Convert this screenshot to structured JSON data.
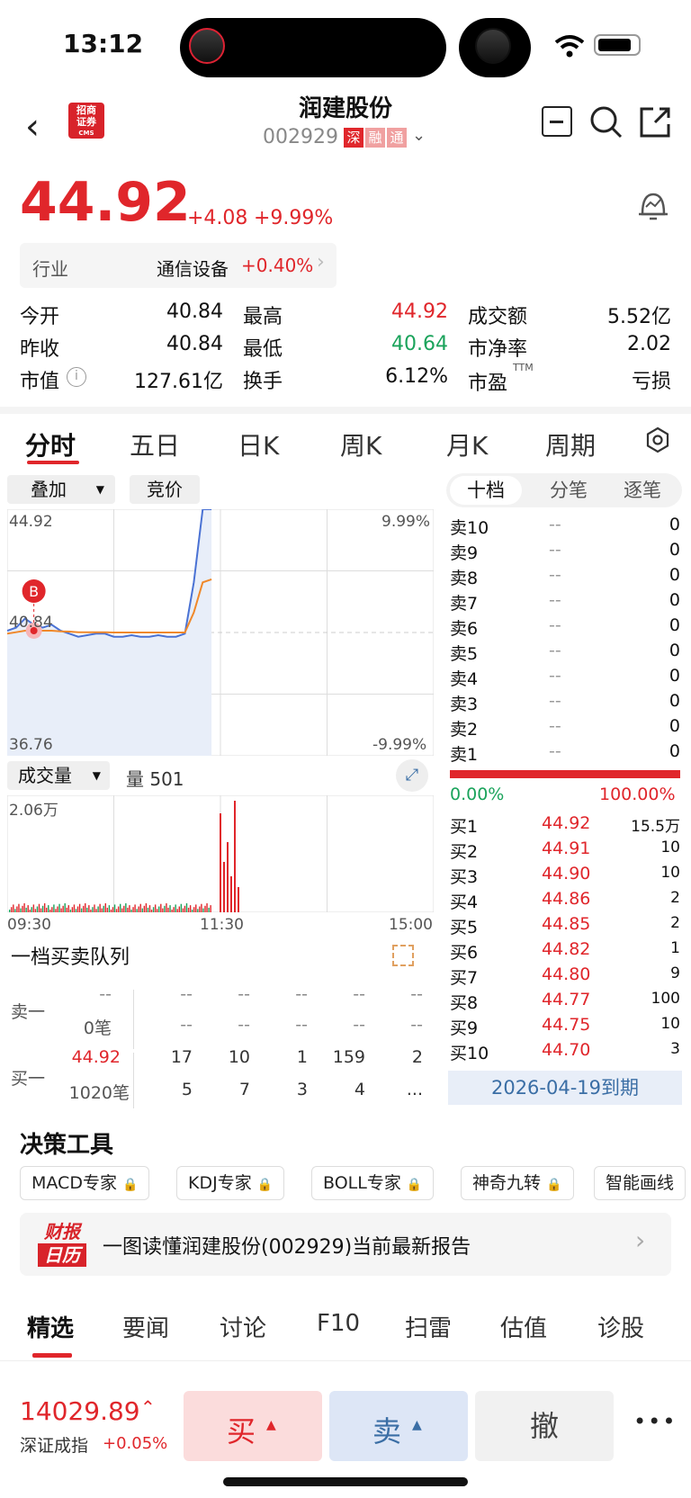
{
  "status": {
    "time": "13:12"
  },
  "header": {
    "title": "润建股份",
    "code": "002929",
    "badges": [
      "深",
      "融",
      "通"
    ],
    "logo_text_line1": "招商",
    "logo_text_line2": "证券",
    "logo_text_line3": "CMS"
  },
  "price": {
    "current": "44.92",
    "change": "+4.08",
    "change_pct": "+9.99%"
  },
  "industry": {
    "label": "行业",
    "name": "通信设备",
    "pct": "+0.40%"
  },
  "quotes": {
    "rows": [
      [
        {
          "k": "今开",
          "v": "40.84"
        },
        {
          "k": "最高",
          "v": "44.92"
        },
        {
          "k": "成交额",
          "v": "5.52亿"
        }
      ],
      [
        {
          "k": "昨收",
          "v": "40.84"
        },
        {
          "k": "最低",
          "v": "40.64"
        },
        {
          "k": "市净率",
          "v": "2.02"
        }
      ],
      [
        {
          "k": "市值",
          "v": "127.61亿"
        },
        {
          "k": "换手",
          "v": "6.12%"
        },
        {
          "k": "市盈",
          "v": "亏损"
        }
      ]
    ],
    "ttm": "TTM"
  },
  "chart_tabs": [
    "分时",
    "五日",
    "日K",
    "周K",
    "月K",
    "周期"
  ],
  "chart_controls": {
    "overlay": "叠加",
    "auction": "竞价"
  },
  "chart_data": {
    "type": "line",
    "x_labels": [
      "09:30",
      "11:30",
      "15:00"
    ],
    "y_top": "44.92",
    "y_mid": "40.84",
    "y_bottom": "36.76",
    "pct_top": "9.99%",
    "pct_bottom": "-9.99%",
    "marker": "B",
    "series": [
      {
        "values": [
          40.9,
          41.0,
          41.3,
          41.1,
          41.0,
          41.1,
          40.9,
          40.8,
          40.7,
          40.75,
          40.8,
          40.8,
          40.7,
          40.7,
          40.75,
          40.7,
          40.7,
          40.75,
          40.7,
          40.7,
          40.8,
          42.5,
          44.92,
          44.92
        ]
      },
      {
        "values": [
          40.8,
          40.85,
          40.9,
          40.9,
          40.9,
          40.9,
          40.88,
          40.87,
          40.85,
          40.85,
          40.85,
          40.85,
          40.84,
          40.84,
          40.84,
          40.84,
          40.84,
          40.84,
          40.84,
          40.84,
          40.84,
          41.5,
          42.5,
          42.6
        ]
      }
    ]
  },
  "volume": {
    "label": "成交量",
    "value_label": "量 501",
    "max_label": "2.06万"
  },
  "queue": {
    "title": "一档买卖队列",
    "sell_label": "卖一",
    "buy_label": "买一",
    "sell_price": "--",
    "sell_count": "0笔",
    "buy_price": "44.92",
    "buy_count": "1020笔",
    "sell_row1": [
      "--",
      "--",
      "--",
      "--",
      "--"
    ],
    "sell_row2": [
      "--",
      "--",
      "--",
      "--",
      "--"
    ],
    "buy_row1": [
      "17",
      "10",
      "1",
      "159",
      "2"
    ],
    "buy_row2": [
      "5",
      "7",
      "3",
      "4",
      "..."
    ]
  },
  "order_tabs": [
    "十档",
    "分笔",
    "逐笔"
  ],
  "asks": [
    {
      "l": "卖10",
      "p": "--",
      "q": "0"
    },
    {
      "l": "卖9",
      "p": "--",
      "q": "0"
    },
    {
      "l": "卖8",
      "p": "--",
      "q": "0"
    },
    {
      "l": "卖7",
      "p": "--",
      "q": "0"
    },
    {
      "l": "卖6",
      "p": "--",
      "q": "0"
    },
    {
      "l": "卖5",
      "p": "--",
      "q": "0"
    },
    {
      "l": "卖4",
      "p": "--",
      "q": "0"
    },
    {
      "l": "卖3",
      "p": "--",
      "q": "0"
    },
    {
      "l": "卖2",
      "p": "--",
      "q": "0"
    },
    {
      "l": "卖1",
      "p": "--",
      "q": "0"
    }
  ],
  "ratio": {
    "left": "0.00%",
    "right": "100.00%"
  },
  "bids": [
    {
      "l": "买1",
      "p": "44.92",
      "q": "15.5万"
    },
    {
      "l": "买2",
      "p": "44.91",
      "q": "10"
    },
    {
      "l": "买3",
      "p": "44.90",
      "q": "10"
    },
    {
      "l": "买4",
      "p": "44.86",
      "q": "2"
    },
    {
      "l": "买5",
      "p": "44.85",
      "q": "2"
    },
    {
      "l": "买6",
      "p": "44.82",
      "q": "1"
    },
    {
      "l": "买7",
      "p": "44.80",
      "q": "9"
    },
    {
      "l": "买8",
      "p": "44.77",
      "q": "100"
    },
    {
      "l": "买9",
      "p": "44.75",
      "q": "10"
    },
    {
      "l": "买10",
      "p": "44.70",
      "q": "3"
    }
  ],
  "expiry": "2026-04-19到期",
  "tools": {
    "title": "决策工具",
    "chips": [
      "MACD专家",
      "KDJ专家",
      "BOLL专家",
      "神奇九转",
      "智能画线"
    ]
  },
  "report": {
    "badge1": "财报",
    "badge2": "日历",
    "text": "一图读懂润建股份(002929)当前最新报告"
  },
  "bottom_tabs": [
    "精选",
    "要闻",
    "讨论",
    "F10",
    "扫雷",
    "估值",
    "诊股"
  ],
  "footer": {
    "index_value": "14029.89",
    "index_name": "深证成指",
    "index_pct": "+0.05%",
    "buy": "买",
    "sell": "卖",
    "cancel": "撤",
    "more": "•••"
  }
}
